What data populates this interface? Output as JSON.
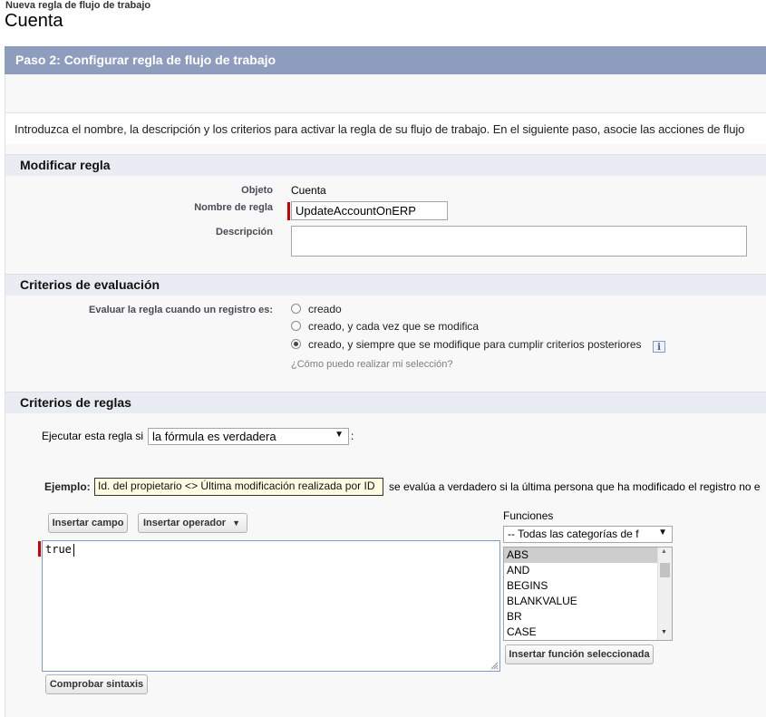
{
  "header": {
    "subtitle": "Nueva regla de flujo de trabajo",
    "title": "Cuenta"
  },
  "step": {
    "title": "Paso 2: Configurar regla de flujo de trabajo"
  },
  "intro_text": "Introduzca el nombre, la descripción y los criterios para activar la regla de su flujo de trabajo. En el siguiente paso, asocie las acciones de flujo",
  "edit_rule": {
    "section_title": "Modificar regla",
    "object_label": "Objeto",
    "object_value": "Cuenta",
    "rule_name_label": "Nombre de regla",
    "rule_name_value": "UpdateAccountOnERP",
    "description_label": "Descripción",
    "description_value": ""
  },
  "evaluation": {
    "section_title": "Criterios de evaluación",
    "question_label": "Evaluar la regla cuando un registro es:",
    "options": [
      "creado",
      "creado, y cada vez que se modifica",
      "creado, y siempre que se modifique para cumplir criterios posteriores"
    ],
    "selected_index": 2,
    "info_icon": "i",
    "help_link": "¿Cómo puedo realizar mi selección?"
  },
  "rule_criteria": {
    "section_title": "Criterios de reglas",
    "run_label": "Ejecutar esta regla si",
    "run_select_value": "la fórmula es verdadera",
    "colon": ":",
    "example_label": "Ejemplo:",
    "example_formula": "Id. del propietario <> Última modificación realizada por ID",
    "example_tail": "se evalúa a verdadero si la última persona que ha modificado el registro no e",
    "insert_field_button": "Insertar campo",
    "insert_operator_button": "Insertar operador",
    "formula_value": "true",
    "check_syntax_button": "Comprobar sintaxis",
    "functions_label": "Funciones",
    "functions_category": "-- Todas las categorías de f",
    "functions_list": [
      "ABS",
      "AND",
      "BEGINS",
      "BLANKVALUE",
      "BR",
      "CASE"
    ],
    "functions_selected_index": 0,
    "insert_function_button": "Insertar función seleccionada"
  },
  "icons": {
    "dropdown": "chevron-down-icon",
    "info": "info-icon",
    "resize": "resize-handle-icon"
  },
  "colors": {
    "step_bar": "#8e9dbe",
    "section_header": "#e9ecf2",
    "required": "#cc0000",
    "example_bg": "#fffde1"
  }
}
